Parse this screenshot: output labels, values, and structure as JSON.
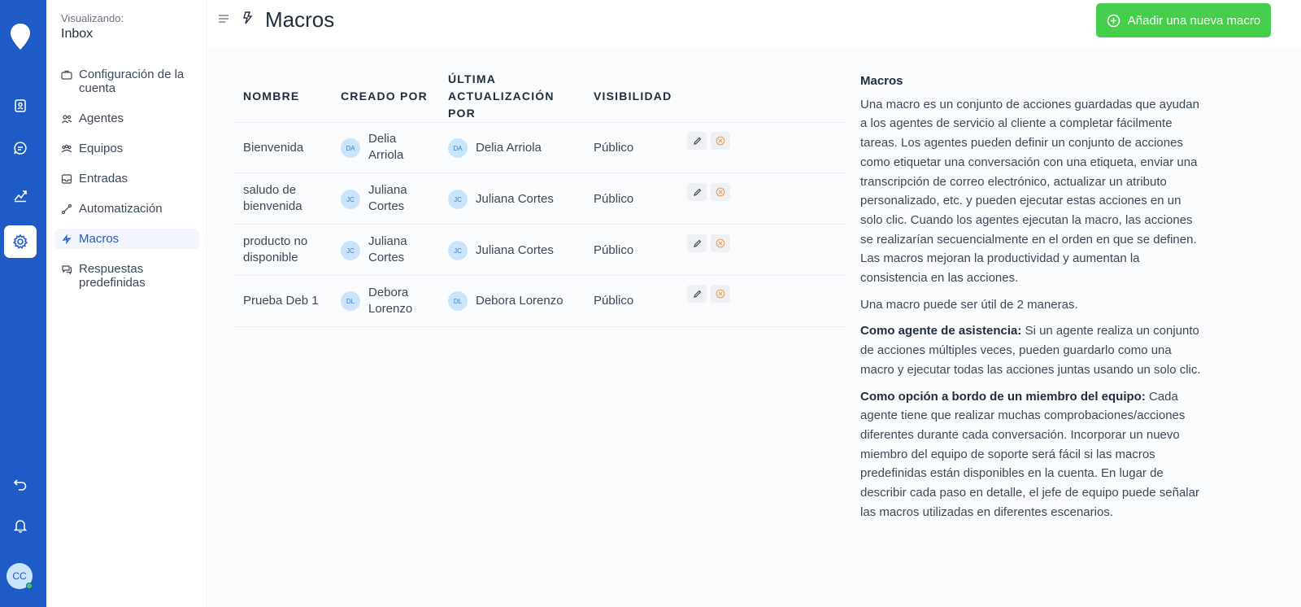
{
  "sidebar": {
    "viewing_label": "Visualizando:",
    "inbox_name": "Inbox",
    "items": [
      {
        "label": "Configuración de la cuenta",
        "icon": "briefcase-icon",
        "active": false
      },
      {
        "label": "Agentes",
        "icon": "people-icon",
        "active": false
      },
      {
        "label": "Equipos",
        "icon": "team-icon",
        "active": false
      },
      {
        "label": "Entradas",
        "icon": "inbox-icon",
        "active": false
      },
      {
        "label": "Automatización",
        "icon": "automation-icon",
        "active": false
      },
      {
        "label": "Macros",
        "icon": "macro-icon",
        "active": true
      },
      {
        "label": "Respuestas predefinidas",
        "icon": "chat-icon",
        "active": false
      }
    ]
  },
  "rail": {
    "avatar_initials": "CC",
    "icons": [
      "contacts-icon",
      "conversations-icon",
      "reports-icon",
      "settings-icon",
      "back-icon",
      "bell-icon"
    ]
  },
  "header": {
    "title": "Macros",
    "add_button_label": "Añadir una nueva macro"
  },
  "table": {
    "columns": [
      "NOMBRE",
      "CREADO POR",
      "ÚLTIMA ACTUALIZACIÓN POR",
      "VISIBILIDAD"
    ],
    "rows": [
      {
        "name": "Bienvenida",
        "created_initials": "DA",
        "created_by": "Delia Arriola",
        "updated_initials": "DA",
        "updated_by": "Delia Arriola",
        "visibility": "Público"
      },
      {
        "name": "saludo de bienvenida",
        "created_initials": "JC",
        "created_by": "Juliana Cortes",
        "updated_initials": "JC",
        "updated_by": "Juliana Cortes",
        "visibility": "Público"
      },
      {
        "name": "producto no disponible",
        "created_initials": "JC",
        "created_by": "Juliana Cortes",
        "updated_initials": "JC",
        "updated_by": "Juliana Cortes",
        "visibility": "Público"
      },
      {
        "name": "Prueba Deb 1",
        "created_initials": "DL",
        "created_by": "Debora Lorenzo",
        "updated_initials": "DL",
        "updated_by": "Debora Lorenzo",
        "visibility": "Público"
      }
    ]
  },
  "help": {
    "title": "Macros",
    "p1": "Una macro es un conjunto de acciones guardadas que ayudan a los agentes de servicio al cliente a completar fácilmente tareas. Los agentes pueden definir un conjunto de acciones como etiquetar una conversación con una etiqueta, enviar una transcripción de correo electrónico, actualizar un atributo personalizado, etc. y pueden ejecutar estas acciones en un solo clic. Cuando los agentes ejecutan la macro, las acciones se realizarían secuencialmente en el orden en que se definen. Las macros mejoran la productividad y aumentan la consistencia en las acciones.",
    "p2": "Una macro puede ser útil de 2 maneras.",
    "p3_bold": "Como agente de asistencia:",
    "p3": " Si un agente realiza un conjunto de acciones múltiples veces, pueden guardarlo como una macro y ejecutar todas las acciones juntas usando un solo clic.",
    "p4_bold": "Como opción a bordo de un miembro del equipo:",
    "p4": " Cada agente tiene que realizar muchas comprobaciones/acciones diferentes durante cada conversación. Incorporar un nuevo miembro del equipo de soporte será fácil si las macros predefinidas están disponibles en la cuenta. En lugar de describir cada paso en detalle, el jefe de equipo puede señalar las macros utilizadas en diferentes escenarios."
  },
  "colors": {
    "rail": "#1f5bc6",
    "add_button": "#44ce4b",
    "delete_icon": "#e8a25b"
  }
}
